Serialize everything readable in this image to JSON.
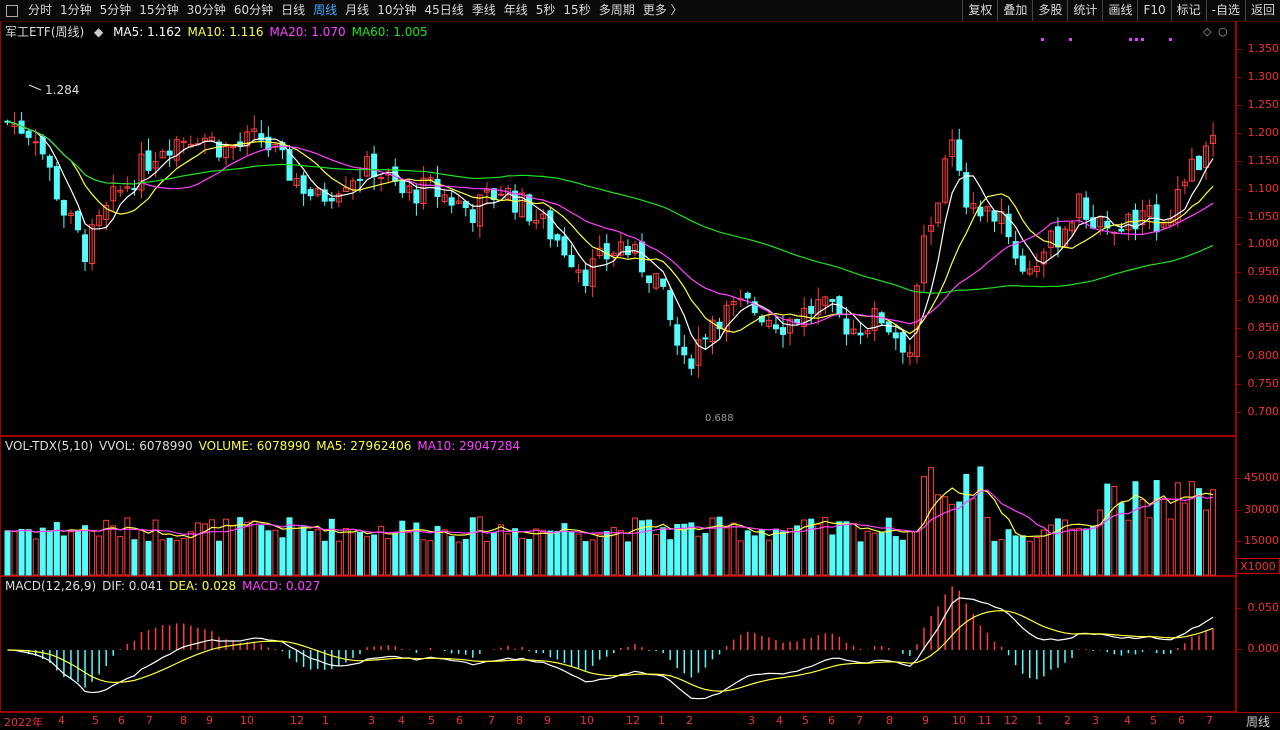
{
  "toolbar": {
    "items": [
      "分时",
      "1分钟",
      "5分钟",
      "15分钟",
      "30分钟",
      "60分钟",
      "日线",
      "周线",
      "月线",
      "10分钟",
      "45日线",
      "季线",
      "年线",
      "5秒",
      "15秒",
      "多周期",
      "更多 〉"
    ],
    "active_index": 7,
    "right_items": [
      "复权",
      "叠加",
      "多股",
      "统计",
      "画线",
      "F10",
      "标记",
      "-自选",
      "返回"
    ]
  },
  "price_panel": {
    "title": "军工ETF(周线)",
    "ma_labels": [
      {
        "text": "MA5: 1.162",
        "color": "#ffffff"
      },
      {
        "text": "MA10: 1.116",
        "color": "#ffff40"
      },
      {
        "text": "MA20: 1.070",
        "color": "#ff40ff"
      },
      {
        "text": "MA60: 1.005",
        "color": "#20e020"
      }
    ],
    "high_marker": "1.284",
    "low_marker": "0.688",
    "y_ticks": [
      "1.350",
      "1.300",
      "1.250",
      "1.200",
      "1.150",
      "1.100",
      "1.050",
      "1.000",
      "0.950",
      "0.900",
      "0.850",
      "0.800",
      "0.750",
      "0.700"
    ]
  },
  "volume_panel": {
    "labels": [
      {
        "text": "VOL-TDX(5,10)",
        "color": "#dddddd"
      },
      {
        "text": "VVOL: 6078990",
        "color": "#dddddd"
      },
      {
        "text": "VOLUME: 6078990",
        "color": "#ffff40"
      },
      {
        "text": "MA5: 27962406",
        "color": "#ffff40"
      },
      {
        "text": "MA10: 29047284",
        "color": "#ff40ff"
      }
    ],
    "y_ticks": [
      "45000",
      "30000",
      "15000"
    ],
    "unit": "X1000"
  },
  "macd_panel": {
    "labels": [
      {
        "text": "MACD(12,26,9)",
        "color": "#dddddd"
      },
      {
        "text": "DIF: 0.041",
        "color": "#dddddd"
      },
      {
        "text": "DEA: 0.028",
        "color": "#ffff40"
      },
      {
        "text": "MACD: 0.027",
        "color": "#ff40ff"
      }
    ],
    "y_ticks": [
      "0.050",
      "0.000"
    ]
  },
  "x_axis": {
    "labels": [
      "2022年",
      "4",
      "5",
      "6",
      "7",
      "8",
      "9",
      "10",
      "12",
      "1",
      "3",
      "4",
      "5",
      "6",
      "7",
      "8",
      "9",
      "10",
      "12",
      "1",
      "2",
      "3",
      "4",
      "5",
      "6",
      "7",
      "8",
      "9",
      "10",
      "11",
      "12",
      "1",
      "2",
      "3",
      "4",
      "5",
      "6",
      "7",
      "8"
    ],
    "period_label": "周线"
  },
  "colors": {
    "up": "#ff3c3c",
    "down": "#54fcfc",
    "ma5": "#ffffff",
    "ma10": "#ffff40",
    "ma20": "#ff40ff",
    "ma60": "#20e020",
    "border": "#a00000"
  }
}
